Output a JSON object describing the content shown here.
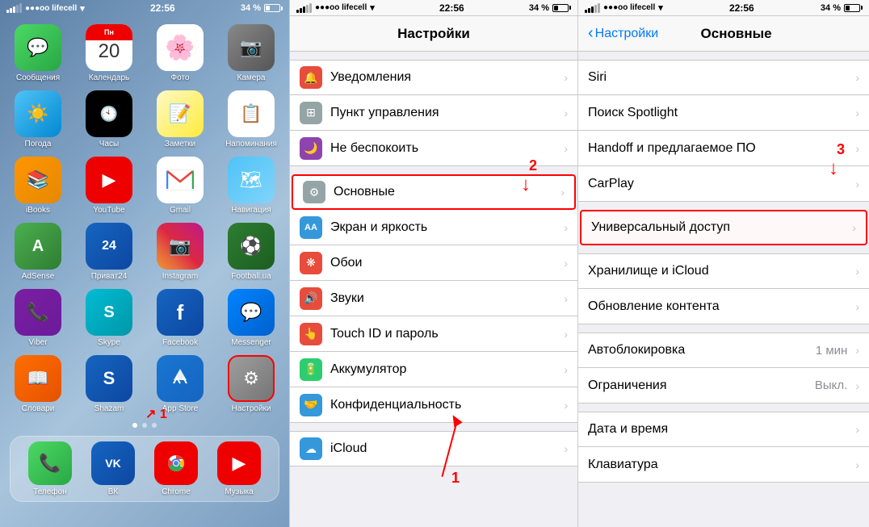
{
  "phone1": {
    "status": {
      "carrier": "●●●oo lifecell",
      "wifi": "▼",
      "time": "22:56",
      "battery_pct": "34 %",
      "battery_icon": "battery"
    },
    "apps": [
      {
        "id": "messages",
        "label": "Сообщения",
        "bg": "bg-messages",
        "icon": "💬"
      },
      {
        "id": "calendar",
        "label": "Календарь",
        "bg": "bg-calendar",
        "icon": "cal",
        "day_name": "Пн",
        "day_num": "20"
      },
      {
        "id": "photos",
        "label": "Фото",
        "bg": "bg-photos",
        "icon": "🌸"
      },
      {
        "id": "camera",
        "label": "Камера",
        "bg": "bg-camera",
        "icon": "📷"
      },
      {
        "id": "weather",
        "label": "Погода",
        "bg": "bg-weather",
        "icon": "☀"
      },
      {
        "id": "clock",
        "label": "Часы",
        "bg": "bg-clock",
        "icon": "🕐"
      },
      {
        "id": "notes",
        "label": "Заметки",
        "bg": "bg-notes",
        "icon": "📝"
      },
      {
        "id": "reminders",
        "label": "Напоминания",
        "bg": "bg-reminders",
        "icon": "📋"
      },
      {
        "id": "ibooks",
        "label": "iBooks",
        "bg": "bg-ibooks",
        "icon": "📚"
      },
      {
        "id": "youtube",
        "label": "YouTube",
        "bg": "bg-youtube",
        "icon": "▶"
      },
      {
        "id": "gmail",
        "label": "Gmail",
        "bg": "bg-gmail",
        "icon": "✉"
      },
      {
        "id": "maps",
        "label": "Навигация",
        "bg": "bg-maps",
        "icon": "🗺"
      },
      {
        "id": "adsense",
        "label": "AdSense",
        "bg": "bg-adsense",
        "icon": "A"
      },
      {
        "id": "privat24",
        "label": "Приват24",
        "bg": "bg-privat",
        "icon": "24"
      },
      {
        "id": "instagram",
        "label": "Instagram",
        "bg": "bg-instagram",
        "icon": "📷"
      },
      {
        "id": "football",
        "label": "Football.ua",
        "bg": "bg-football",
        "icon": "⚽"
      },
      {
        "id": "viber",
        "label": "Viber",
        "bg": "bg-viber",
        "icon": "📞"
      },
      {
        "id": "skype",
        "label": "Skype",
        "bg": "bg-skype",
        "icon": "S"
      },
      {
        "id": "facebook",
        "label": "Facebook",
        "bg": "bg-facebook",
        "icon": "f"
      },
      {
        "id": "messenger",
        "label": "Messenger",
        "bg": "bg-messenger",
        "icon": "💬"
      },
      {
        "id": "slovari",
        "label": "Словари",
        "bg": "bg-slovari",
        "icon": "A"
      },
      {
        "id": "shazam",
        "label": "Shazam",
        "bg": "bg-shazam",
        "icon": "S"
      },
      {
        "id": "appstore",
        "label": "App Store",
        "bg": "bg-appstore",
        "icon": "A"
      },
      {
        "id": "settings",
        "label": "Настройки",
        "bg": "bg-settings",
        "icon": "⚙"
      }
    ],
    "dock": [
      {
        "id": "phone",
        "label": "Телефон",
        "icon": "📞",
        "bg": "bg-messages"
      },
      {
        "id": "vk",
        "label": "ВК",
        "icon": "VK",
        "bg": "bg-skype"
      },
      {
        "id": "chrome",
        "label": "Chrome",
        "icon": "🌐",
        "bg": "bg-youtube"
      },
      {
        "id": "music",
        "label": "Музыка",
        "icon": "▶",
        "bg": "bg-youtube"
      }
    ]
  },
  "phone2": {
    "status": {
      "carrier": "●●●oo lifecell",
      "time": "22:56",
      "battery_pct": "34 %"
    },
    "title": "Настройки",
    "items": [
      {
        "id": "notifications",
        "label": "Уведомления",
        "icon": "🔔",
        "bg": "#e74c3c"
      },
      {
        "id": "control",
        "label": "Пункт управления",
        "icon": "⊞",
        "bg": "#95a5a6"
      },
      {
        "id": "donotdisturb",
        "label": "Не беспокоить",
        "icon": "🌙",
        "bg": "#8e44ad"
      },
      {
        "id": "general",
        "label": "Основные",
        "icon": "⚙",
        "bg": "#95a5a6",
        "highlighted": true
      },
      {
        "id": "display",
        "label": "Экран и яркость",
        "icon": "AA",
        "bg": "#3498db"
      },
      {
        "id": "wallpaper",
        "label": "Обои",
        "icon": "❋",
        "bg": "#e74c3c"
      },
      {
        "id": "sounds",
        "label": "Звуки",
        "icon": "🔊",
        "bg": "#e74c3c"
      },
      {
        "id": "touchid",
        "label": "Touch ID и пароль",
        "icon": "👆",
        "bg": "#e74c3c"
      },
      {
        "id": "battery",
        "label": "Аккумулятор",
        "icon": "🔋",
        "bg": "#2ecc71"
      },
      {
        "id": "privacy",
        "label": "Конфиденциальность",
        "icon": "🤝",
        "bg": "#3498db"
      },
      {
        "id": "icloud",
        "label": "iCloud",
        "icon": "☁",
        "bg": "#3498db"
      }
    ],
    "annotation_number": "2",
    "annotation_arrow": "↓"
  },
  "phone3": {
    "status": {
      "carrier": "●●●oo lifecell",
      "time": "22:56",
      "battery_pct": "34 %"
    },
    "back_label": "Настройки",
    "title": "Основные",
    "items": [
      {
        "id": "siri",
        "label": "Siri",
        "value": ""
      },
      {
        "id": "spotlight",
        "label": "Поиск Spotlight",
        "value": ""
      },
      {
        "id": "handoff",
        "label": "Handoff и предлагаемое ПО",
        "value": ""
      },
      {
        "id": "carplay",
        "label": "CarPlay",
        "value": ""
      },
      {
        "id": "universal",
        "label": "Универсальный доступ",
        "value": "",
        "highlighted": true
      },
      {
        "id": "storage",
        "label": "Хранилище и iCloud",
        "value": ""
      },
      {
        "id": "bgrefresh",
        "label": "Обновление контента",
        "value": ""
      },
      {
        "id": "autolock",
        "label": "Автоблокировка",
        "value": "1 мин"
      },
      {
        "id": "restrictions",
        "label": "Ограничения",
        "value": "Выкл."
      },
      {
        "id": "datetime",
        "label": "Дата и время",
        "value": ""
      },
      {
        "id": "keyboard",
        "label": "Клавиатура",
        "value": ""
      }
    ],
    "annotation_number": "3",
    "annotation_arrow": "↓"
  },
  "annotations": {
    "arrow1_label": "1",
    "arrow2_label": "2",
    "arrow3_label": "3"
  }
}
